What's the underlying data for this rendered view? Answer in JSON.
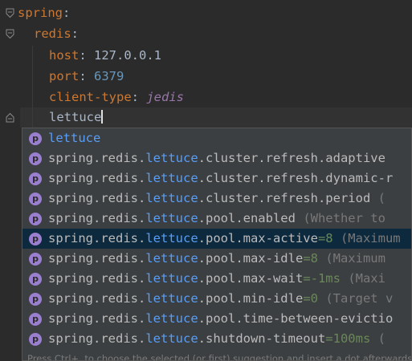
{
  "editor": {
    "lines": [
      {
        "key": "spring",
        "colon": ":",
        "value": ""
      },
      {
        "key": "redis",
        "colon": ":",
        "value": ""
      },
      {
        "key": "host",
        "colon": ": ",
        "value": "127.0.0.1"
      },
      {
        "key": "port",
        "colon": ": ",
        "value": "6379"
      },
      {
        "key": "client-type",
        "colon": ": ",
        "value": "jedis"
      }
    ],
    "typed_text": "lettuce"
  },
  "completion": {
    "items": [
      {
        "prefix": "",
        "match": "lettuce",
        "suffix": "",
        "default": "",
        "hint": ""
      },
      {
        "prefix": "spring.redis.",
        "match": "lettuce",
        "suffix": ".cluster.refresh.adaptive",
        "default": "",
        "hint": ""
      },
      {
        "prefix": "spring.redis.",
        "match": "lettuce",
        "suffix": ".cluster.refresh.dynamic-r",
        "default": "",
        "hint": ""
      },
      {
        "prefix": "spring.redis.",
        "match": "lettuce",
        "suffix": ".cluster.refresh.period",
        "default": "",
        "hint": " ("
      },
      {
        "prefix": "spring.redis.",
        "match": "lettuce",
        "suffix": ".pool.enabled",
        "default": "",
        "hint": " (Whether to"
      },
      {
        "prefix": "spring.redis.",
        "match": "lettuce",
        "suffix": ".pool.max-active",
        "default": "=8",
        "hint": " (Maximum"
      },
      {
        "prefix": "spring.redis.",
        "match": "lettuce",
        "suffix": ".pool.max-idle",
        "default": "=8",
        "hint": " (Maximum"
      },
      {
        "prefix": "spring.redis.",
        "match": "lettuce",
        "suffix": ".pool.max-wait",
        "default": "=-1ms",
        "hint": " (Maxi"
      },
      {
        "prefix": "spring.redis.",
        "match": "lettuce",
        "suffix": ".pool.min-idle",
        "default": "=0",
        "hint": " (Target v"
      },
      {
        "prefix": "spring.redis.",
        "match": "lettuce",
        "suffix": ".pool.time-between-evictio",
        "default": "",
        "hint": ""
      },
      {
        "prefix": "spring.redis.",
        "match": "lettuce",
        "suffix": ".shutdown-timeout",
        "default": "=100ms",
        "hint": " ("
      }
    ],
    "selected_index": 5,
    "badge_letter": "p",
    "footer": "Press Ctrl+. to choose the selected (or first) suggestion and insert a dot afterwards"
  },
  "colors": {
    "background": "#2b2b2b",
    "key": "#cc7832",
    "match": "#589df6",
    "selection": "#0d293e"
  }
}
